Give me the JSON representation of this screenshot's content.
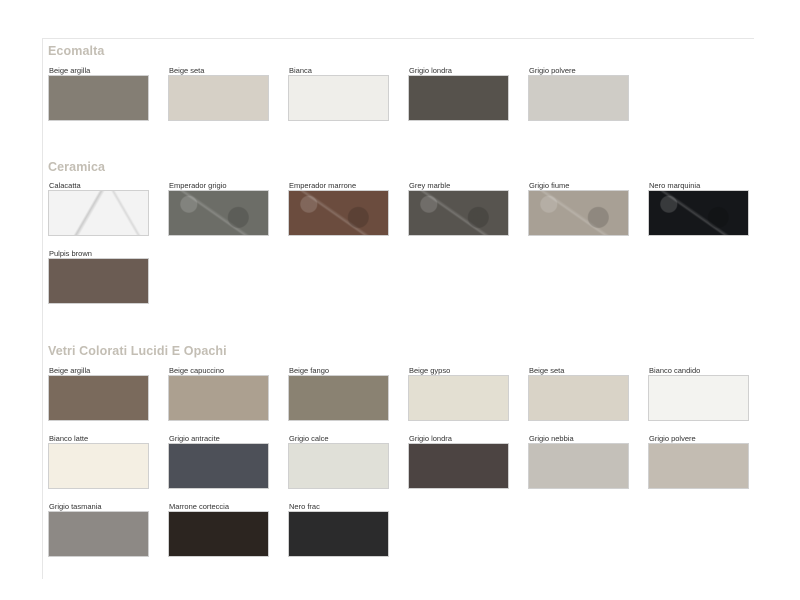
{
  "sections": [
    {
      "title": "Ecomalta",
      "swatches": [
        {
          "label": "Beige argilla",
          "color": "#847e74"
        },
        {
          "label": "Beige seta",
          "color": "#d6d0c6"
        },
        {
          "label": "Bianca",
          "color": "#efeeea"
        },
        {
          "label": "Grigio londra",
          "color": "#56524c"
        },
        {
          "label": "Grigio polvere",
          "color": "#cfccc6"
        }
      ]
    },
    {
      "title": "Ceramica",
      "swatches": [
        {
          "label": "Calacatta",
          "color": "#f3f3f3"
        },
        {
          "label": "Emperador grigio",
          "color": "#6c6d67"
        },
        {
          "label": "Emperador marrone",
          "color": "#6b4c3e"
        },
        {
          "label": "Grey marble",
          "color": "#57544f"
        },
        {
          "label": "Grigio fiume",
          "color": "#a8a095"
        },
        {
          "label": "Nero marquinia",
          "color": "#15171a"
        },
        {
          "label": "Pulpis brown",
          "color": "#6b5c53"
        }
      ]
    },
    {
      "title": "Vetri Colorati Lucidi E Opachi",
      "swatches": [
        {
          "label": "Beige argilla",
          "color": "#7a6a5c"
        },
        {
          "label": "Beige capuccino",
          "color": "#aca090"
        },
        {
          "label": "Beige fango",
          "color": "#8a8272"
        },
        {
          "label": "Beige gypso",
          "color": "#e3dfd2"
        },
        {
          "label": "Beige seta",
          "color": "#d9d3c7"
        },
        {
          "label": "Bianco candido",
          "color": "#f3f3f0"
        },
        {
          "label": "Bianco latte",
          "color": "#f4efe3"
        },
        {
          "label": "Grigio antracite",
          "color": "#4d5058"
        },
        {
          "label": "Grigio calce",
          "color": "#e0e0d8"
        },
        {
          "label": "Grigio londra",
          "color": "#4c4442"
        },
        {
          "label": "Grigio nebbia",
          "color": "#c4c0b9"
        },
        {
          "label": "Grigio polvere",
          "color": "#c3bcb2"
        },
        {
          "label": "Grigio tasmania",
          "color": "#8d8985"
        },
        {
          "label": "Marrone corteccia",
          "color": "#2c2520"
        },
        {
          "label": "Nero frac",
          "color": "#2b2b2c"
        }
      ]
    }
  ]
}
